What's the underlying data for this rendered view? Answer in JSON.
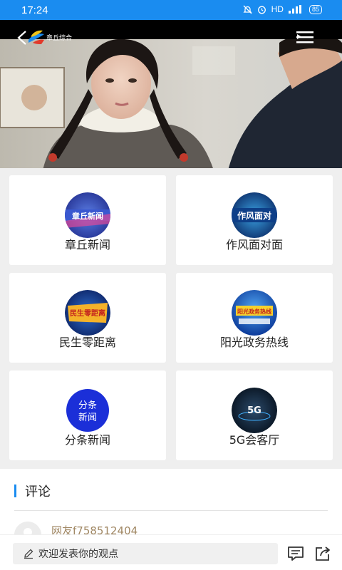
{
  "status_bar": {
    "time": "17:24",
    "network": "HD",
    "battery": "85"
  },
  "player": {
    "channel_name": "章丘综合"
  },
  "programs": [
    {
      "label": "章丘新闻",
      "badge": "章丘新闻",
      "icon": "zhangqiu-news-icon"
    },
    {
      "label": "作风面对面",
      "badge": "作风面对",
      "icon": "zuofeng-icon"
    },
    {
      "label": "民生零距离",
      "badge": "民生零距离",
      "icon": "minsheng-icon"
    },
    {
      "label": "阳光政务热线",
      "badge": "阳光政务热线",
      "icon": "yangguang-icon"
    },
    {
      "label": "分条新闻",
      "badge": "分条新闻",
      "icon": "fentiao-icon"
    },
    {
      "label": "5G会客厅",
      "badge": "5G",
      "icon": "5g-icon"
    }
  ],
  "comments": {
    "title": "评论",
    "items": [
      {
        "username": "网友f758512404"
      }
    ]
  },
  "input_bar": {
    "placeholder": "欢迎发表你的观点"
  },
  "colors": {
    "brand": "#1a8cf0",
    "username": "#a08763"
  }
}
